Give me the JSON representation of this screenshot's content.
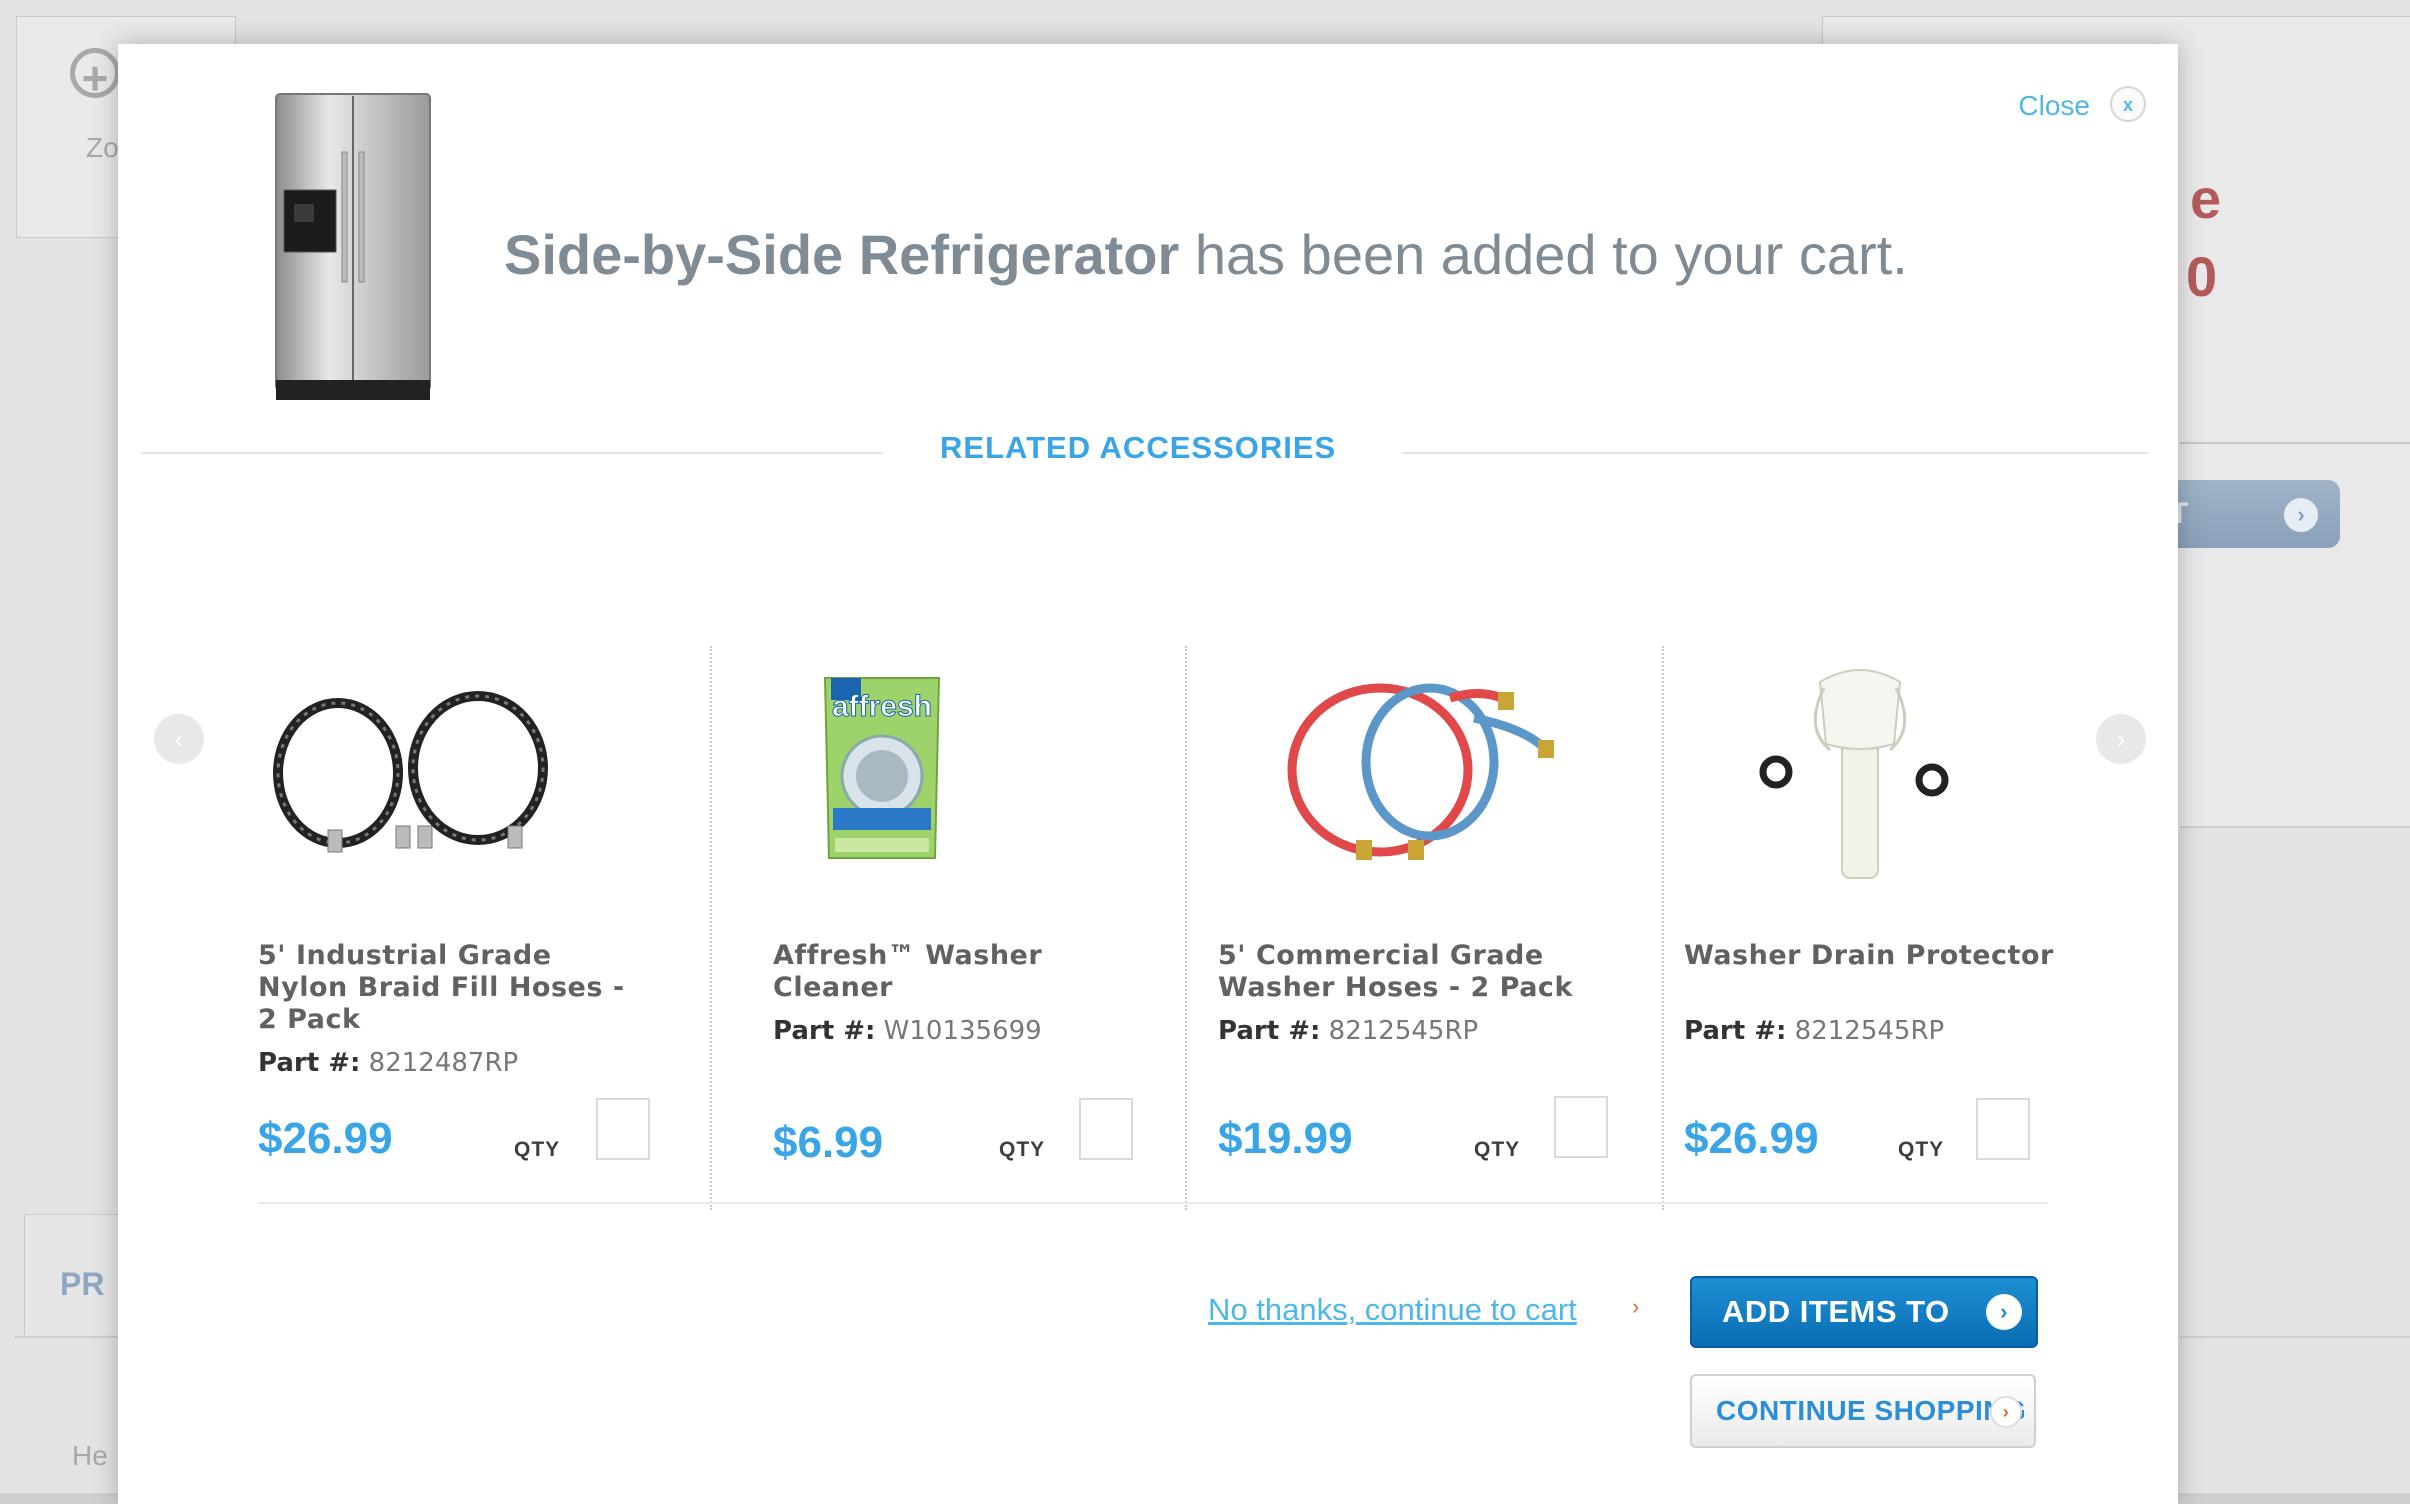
{
  "background": {
    "zoom_label": "Zo",
    "right_text_line1": "e",
    "right_text_line2": "0",
    "right_button_label": "T",
    "tab_label": "PR",
    "help_text": "He"
  },
  "modal": {
    "close_label": "Close",
    "headline_product": "Side-by-Side Refrigerator",
    "headline_suffix": " has been added to your cart.",
    "section_title": "RELATED ACCESSORIES",
    "products": [
      {
        "name": "5' Industrial Grade Nylon Braid Fill Hoses - 2 Pack",
        "part_label": "Part #:",
        "part_number": "8212487RP",
        "price": "$26.99",
        "qty_label": "QTY",
        "icon": "braided-hoses"
      },
      {
        "name": "Affresh™ Washer Cleaner",
        "part_label": "Part #:",
        "part_number": "W10135699",
        "price": "$6.99",
        "qty_label": "QTY",
        "icon": "affresh-pouch",
        "brand_text": "affresh"
      },
      {
        "name": "5' Commercial Grade Washer Hoses - 2 Pack",
        "part_label": "Part #:",
        "part_number": "8212545RP",
        "price": "$19.99",
        "qty_label": "QTY",
        "icon": "red-blue-hoses"
      },
      {
        "name": "Washer Drain Protector",
        "part_label": "Part #:",
        "part_number": "8212545RP",
        "price": "$26.99",
        "qty_label": "QTY",
        "icon": "drain-protector"
      }
    ],
    "no_thanks_label": "No thanks, continue to cart",
    "add_items_label": "ADD ITEMS TO CART",
    "continue_shopping_label": "CONTINUE SHOPPING"
  },
  "colors": {
    "accent_blue": "#3aa5e6",
    "button_blue": "#0a6db4",
    "arrow_orange": "#e0683a"
  }
}
